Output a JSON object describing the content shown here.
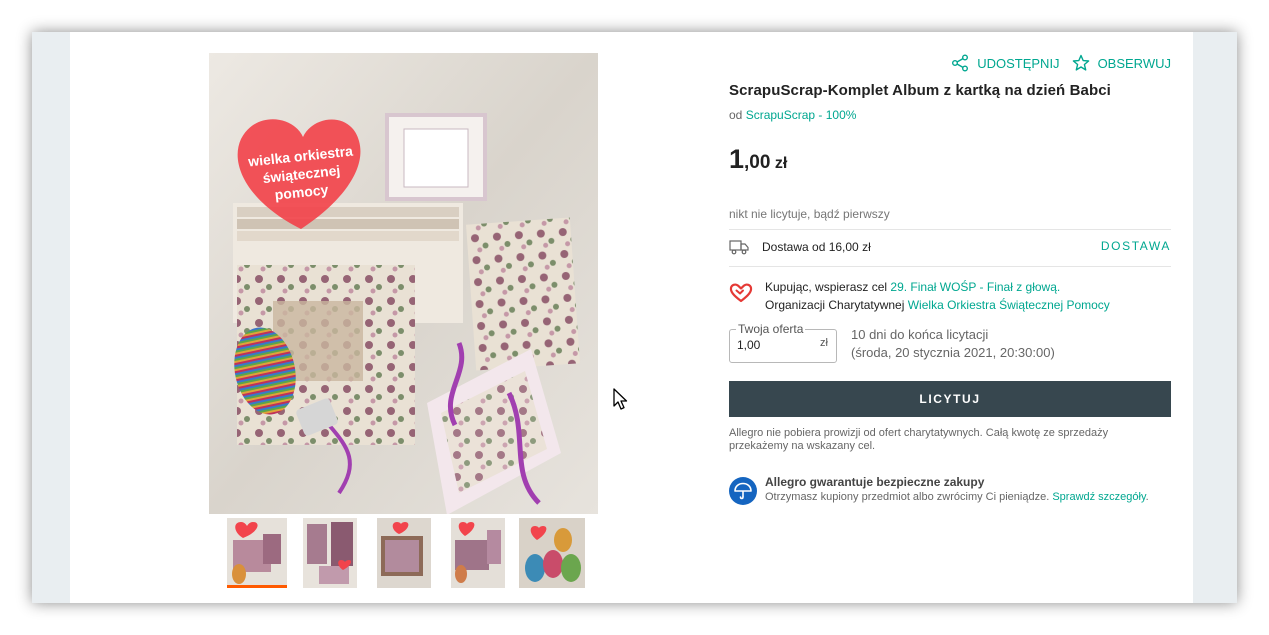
{
  "colors": {
    "accent": "#00a790",
    "button": "#37474f",
    "active_thumb": "#ff5a00",
    "heart": "#e53935",
    "shield": "#1565c0"
  },
  "share": {
    "label": "UDOSTĘPNIJ",
    "icon": "share-icon"
  },
  "follow": {
    "label": "OBSERWUJ",
    "icon": "star-outline-icon"
  },
  "product": {
    "title": "ScrapuScrap-Komplet Album z kartką na dzień Babci",
    "seller_prefix": "od",
    "seller_name": "ScrapuScrap - 100%"
  },
  "price": {
    "integer": "1",
    "decimal": ",00",
    "currency": "zł"
  },
  "bids_info": "nikt nie licytuje, bądź pierwszy",
  "delivery": {
    "text": "Dostawa od 16,00 zł",
    "link": "DOSTAWA",
    "icon": "truck-icon"
  },
  "charity": {
    "line1_text": "Kupując, wspierasz cel ",
    "line1_link": "29. Finał WOŚP - Finał z głową.",
    "line2_text": "Organizacji Charytatywnej ",
    "line2_link": "Wielka Orkiestra Świątecznej Pomocy",
    "icon": "heart-icon"
  },
  "offer": {
    "legend": "Twoja oferta",
    "value": "1,00",
    "currency": "zł"
  },
  "ends": {
    "line1": "10 dni do końca licytacji",
    "line2": "(środa, 20 stycznia 2021, 20:30:00)"
  },
  "bid_button": "LICYTUJ",
  "note": "Allegro nie pobiera prowizji od ofert charytatywnych. Całą kwotę ze sprzedaży przekażemy na wskazany cel.",
  "guarantee": {
    "title": "Allegro gwarantuje bezpieczne zakupy",
    "text": "Otrzymasz kupiony przedmiot albo zwrócimy Ci pieniądze. ",
    "link": "Sprawdź szczegóły",
    "suffix": ".",
    "icon": "umbrella-shield-icon"
  },
  "gallery": {
    "heart_text": [
      "wielka orkiestra",
      "świątecznej",
      "pomocy"
    ],
    "thumb_count": 5,
    "active_thumb": 1
  }
}
